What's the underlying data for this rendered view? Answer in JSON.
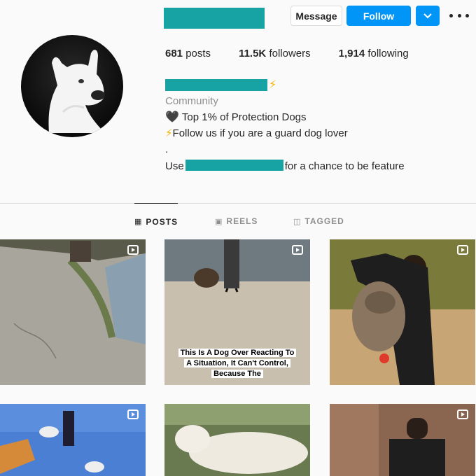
{
  "header": {
    "message_label": "Message",
    "follow_label": "Follow",
    "dropdown_icon": "chevron-down-icon",
    "more_icon": "more-dots-icon"
  },
  "stats": {
    "posts_count": "681",
    "posts_label": "posts",
    "followers_count": "11.5K",
    "followers_label": "followers",
    "following_count": "1,914",
    "following_label": "following"
  },
  "bio": {
    "category": "Community",
    "line1": "Top 1% of Protection Dogs",
    "line2": "Follow us if you are a guard dog lover",
    "line3": ".",
    "line4_prefix": "Use",
    "line4_suffix": "for a chance to be feature"
  },
  "tabs": [
    {
      "label": "POSTS",
      "icon": "grid-icon",
      "active": true
    },
    {
      "label": "REELS",
      "icon": "reels-icon",
      "active": false
    },
    {
      "label": "TAGGED",
      "icon": "tagged-icon",
      "active": false
    }
  ],
  "posts": [
    {
      "type": "reel"
    },
    {
      "type": "reel",
      "caption": "This Is A Dog Over Reacting To A Situation, It Can't Control, Because The"
    },
    {
      "type": "reel"
    },
    {
      "type": "reel"
    },
    {
      "type": "image"
    },
    {
      "type": "reel"
    }
  ],
  "colors": {
    "accent": "#0095f6",
    "redaction": "#17a3a3",
    "bolt": "#f5b400"
  }
}
